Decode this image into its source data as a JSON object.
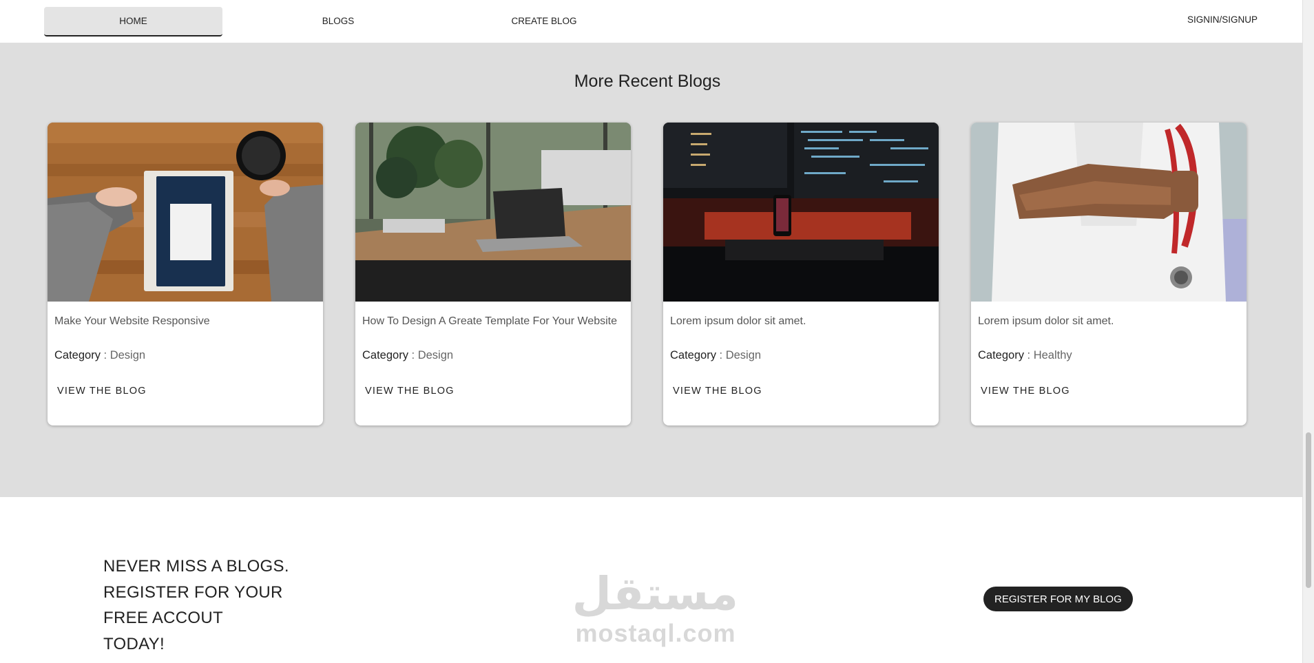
{
  "nav": {
    "home": "HOME",
    "blogs": "BLOGS",
    "create_blog": "CREATE BLOG",
    "signin": "SIGNIN/SIGNUP"
  },
  "recent": {
    "title": "More Recent Blogs",
    "cards": [
      {
        "title": "Make Your Website Responsive",
        "category_label": "Category",
        "category": "Design",
        "link": "VIEW THE BLOG",
        "image": "notebook-coffee-on-wood-desk"
      },
      {
        "title": "How To Design A Greate Template For Your Website",
        "category_label": "Category",
        "category": "Design",
        "link": "VIEW THE BLOG",
        "image": "laptop-on-office-desk"
      },
      {
        "title": "Lorem ipsum dolor sit amet.",
        "category_label": "Category",
        "category": "Design",
        "link": "VIEW THE BLOG",
        "image": "code-monitors-dark-desk"
      },
      {
        "title": "Lorem ipsum dolor sit amet.",
        "category_label": "Category",
        "category": "Healthy",
        "link": "VIEW THE BLOG",
        "image": "doctor-with-stethoscope"
      }
    ]
  },
  "cta": {
    "lines": [
      "NEVER MISS A BLOGS.",
      "REGISTER FOR YOUR",
      "FREE ACCOUT",
      "TODAY!"
    ],
    "button": "REGISTER FOR MY BLOG"
  },
  "watermark": {
    "arabic": "مستقل",
    "latin": "mostaql.com"
  },
  "colors": {
    "section_bg": "#dedede",
    "button_bg": "#222222",
    "accent_text": "#222222"
  }
}
